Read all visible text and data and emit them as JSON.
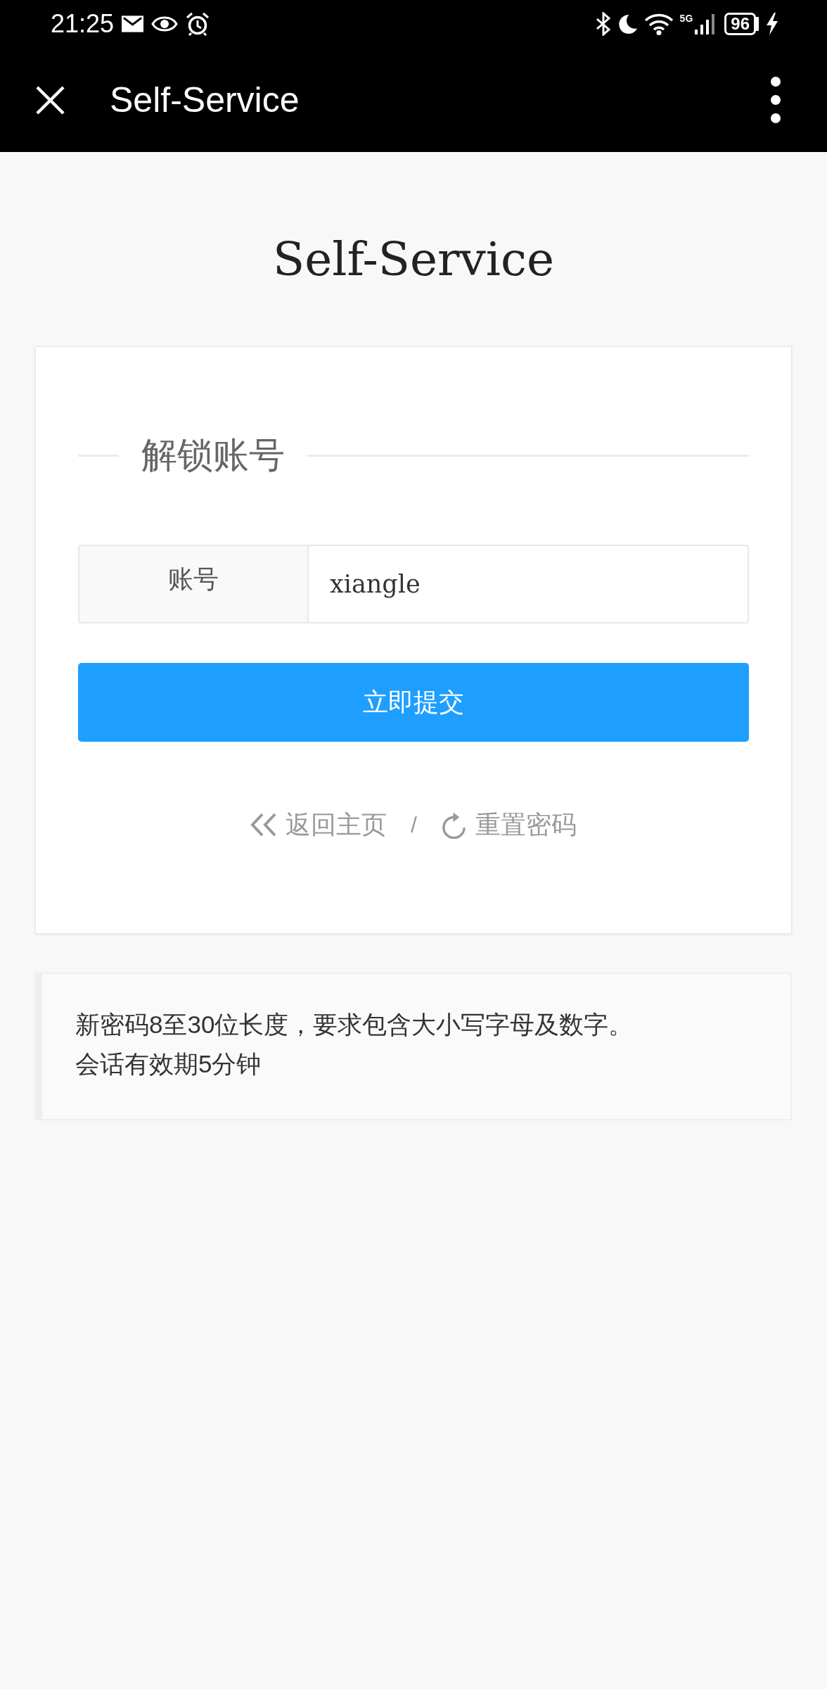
{
  "status_bar": {
    "time": "21:25",
    "network": "5G",
    "battery": "96"
  },
  "app_bar": {
    "title": "Self-Service"
  },
  "page": {
    "heading": "Self-Service"
  },
  "form_card": {
    "legend": "解锁账号",
    "account_field": {
      "label": "账号",
      "value": "xiangle"
    },
    "submit_button": "立即提交",
    "links": [
      {
        "kind": "back",
        "label": "返回主页"
      },
      {
        "kind": "reset",
        "label": "重置密码"
      }
    ],
    "separator": "/"
  },
  "notice": {
    "lines": [
      "新密码8至30位长度，要求包含大小写字母及数字。",
      "会话有效期5分钟"
    ]
  }
}
